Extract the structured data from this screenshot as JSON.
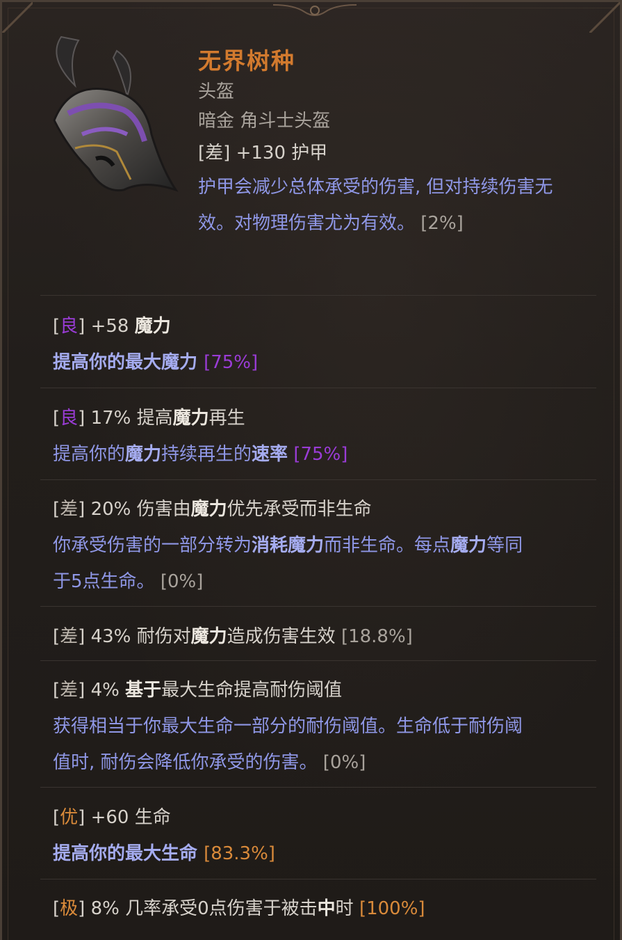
{
  "item": {
    "name": "无界树种",
    "slot": "头盔",
    "type": "暗金 角斗士头盔",
    "base_stat": {
      "tier_open": "[",
      "tier": "差",
      "tier_close": "]",
      "text": " +130 护甲"
    },
    "base_desc_1": "护甲会减少总体承受的伤害, 但对持续伤害无",
    "base_desc_2": "效。对物理伤害尤为有效。",
    "base_pct": "[2%]",
    "icon": "helmet-icon"
  },
  "affixes": [
    {
      "tier": "良",
      "pre": " +58 ",
      "bold": "魔力",
      "post": "",
      "desc": "提高你的最大魔力 ",
      "pct": "[75%]"
    },
    {
      "tier": "良",
      "pre": " 17% 提高",
      "bold": "魔力",
      "post": "再生",
      "desc_pre": "提高你的",
      "desc_b1": "魔力",
      "desc_mid": "持续再生的",
      "desc_b2": "速率",
      "desc_post": " ",
      "pct": "[75%]"
    },
    {
      "tier": "差",
      "pre": " 20% 伤害由",
      "bold": "魔力",
      "post": "优先承受而非生命",
      "desc1_pre": "你承受伤害的一部分转为",
      "desc1_b": "消耗魔力",
      "desc1_mid": "而非生命。每点",
      "desc1_b2": "魔力",
      "desc1_post": "等同",
      "desc2": "于5点生命。 ",
      "pct": "[0%]"
    },
    {
      "tier": "差",
      "pre": " 43% 耐伤对",
      "bold": "魔力",
      "post": "造成伤害生效 ",
      "pct": "[18.8%]"
    },
    {
      "tier": "差",
      "pre": " 4% ",
      "bold": "基于",
      "post": "最大生命提高耐伤阈值",
      "desc1": "获得相当于你最大生命一部分的耐伤阈值。生命低于耐伤阈",
      "desc2": "值时, 耐伤会降低你承受的伤害。 ",
      "pct": "[0%]"
    },
    {
      "tier": "优",
      "pre": " +60 生命",
      "desc": "提高你的最大生命 ",
      "pct": "[83.3%]"
    },
    {
      "tier": "极",
      "pre": " 8% 几率承受0点伤害于被击",
      "bold": "中",
      "post": "时 ",
      "pct": "[100%]"
    }
  ],
  "brackets": {
    "open": "[",
    "close": "]"
  },
  "colors": {
    "unique_name": "#d27a2e",
    "tier_good": "#9a3cd6",
    "tier_great": "#d98a3a",
    "desc_blue": "#8f97e6"
  }
}
